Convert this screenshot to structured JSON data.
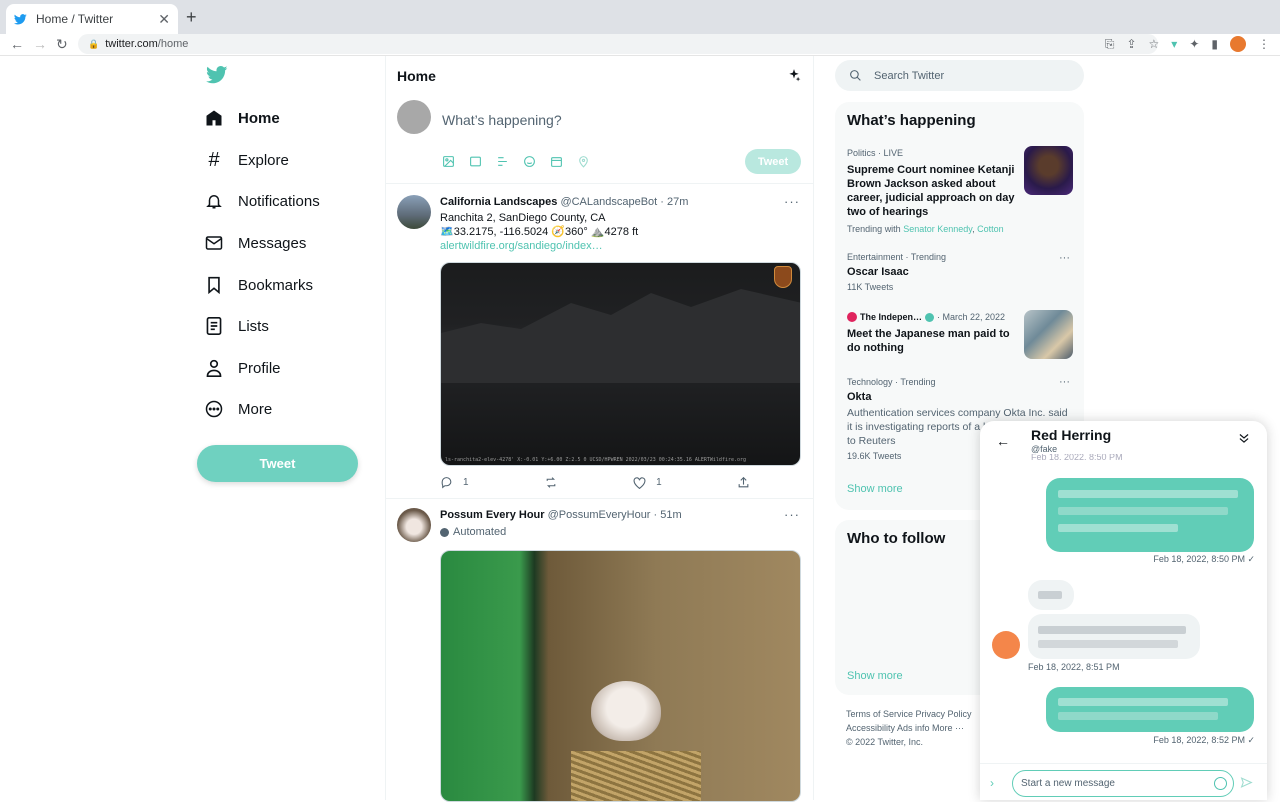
{
  "browser": {
    "tab_title": "Home / Twitter",
    "tab_close": "✕",
    "new_tab": "+",
    "url_host": "twitter.com",
    "url_path": "/home"
  },
  "sidebar": {
    "items": [
      {
        "label": "Home",
        "icon": "home-icon"
      },
      {
        "label": "Explore",
        "icon": "hashtag-icon"
      },
      {
        "label": "Notifications",
        "icon": "bell-icon"
      },
      {
        "label": "Messages",
        "icon": "envelope-icon"
      },
      {
        "label": "Bookmarks",
        "icon": "bookmark-icon"
      },
      {
        "label": "Lists",
        "icon": "list-icon"
      },
      {
        "label": "Profile",
        "icon": "person-icon"
      },
      {
        "label": "More",
        "icon": "more-circle-icon"
      }
    ],
    "tweet_button": "Tweet"
  },
  "main": {
    "title": "Home",
    "compose_placeholder": "What’s happening?",
    "compose_button": "Tweet",
    "tweets": [
      {
        "name": "California Landscapes",
        "handle": "@CALandscapeBot",
        "time": "· 27m",
        "line1": "Ranchita 2, SanDiego County, CA",
        "line2": "🗺️33.2175, -116.5024 🧭360° ⛰️4278 ft",
        "link": "alertwildfire.org/sandiego/index…",
        "media_caption": "ls-ranchita2-elev-4278' X:-0.01 Y:+6.00 Z:2.5 0 UCSD/HPWREN 2022/03/23 00:24:35.16 ALERTWildfire.org",
        "replies": "1",
        "likes": "1"
      },
      {
        "name": "Possum Every Hour",
        "handle": "@PossumEveryHour",
        "time": "· 51m",
        "label": "Automated"
      }
    ]
  },
  "right": {
    "search_placeholder": "Search Twitter",
    "happening_title": "What’s happening",
    "trends": [
      {
        "meta": "Politics · LIVE",
        "title": "Supreme Court nominee Ketanji Brown Jackson asked about career, judicial approach on day two of hearings",
        "sub_prefix": "Trending with ",
        "sub_link1": "Senator Kennedy",
        "sub_sep": ", ",
        "sub_link2": "Cotton"
      },
      {
        "meta": "Entertainment · Trending",
        "title": "Oscar Isaac",
        "sub": "11K Tweets"
      },
      {
        "meta_source": "The Indepen…",
        "meta_date": "· March 22, 2022",
        "title": "Meet the Japanese man paid to do nothing"
      },
      {
        "meta": "Technology · Trending",
        "title": "Okta",
        "desc": "Authentication services company Okta Inc. said it is investigating reports of a breach, according to Reuters",
        "sub": "19.6K Tweets"
      }
    ],
    "show_more": "Show more",
    "follow_title": "Who to follow",
    "follow_show_more": "Show more",
    "footer_line1": "Terms of Service   Privacy Policy",
    "footer_line2": "Accessibility   Ads info   More ···",
    "footer_line3": "© 2022 Twitter, Inc."
  },
  "dm": {
    "name": "Red Herring",
    "handle": "@fake",
    "clipped_time": "Feb 18, 2022, 8:50 PM",
    "time1": "Feb 18, 2022, 8:50 PM ✓",
    "time2": "Feb 18, 2022, 8:51 PM",
    "time3": "Feb 18, 2022, 8:52 PM ✓",
    "input_placeholder": "Start a new message"
  },
  "colors": {
    "accent": "#4fc3b0",
    "bubble_out": "#61cdb7",
    "tweet_button": "#6fd1c0"
  }
}
